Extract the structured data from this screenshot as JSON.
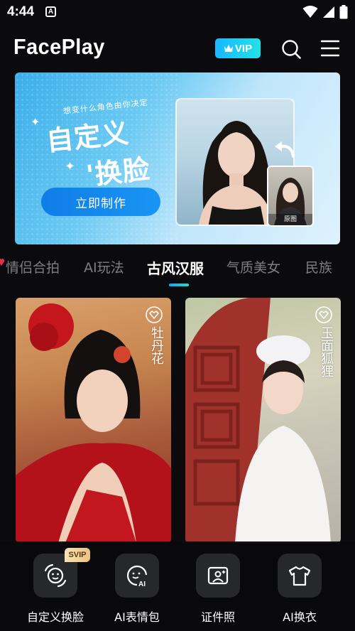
{
  "status_bar": {
    "time": "4:44",
    "notif_icon_letter": "A"
  },
  "header": {
    "logo": "FacePlay",
    "vip_label": "VIP"
  },
  "banner": {
    "subtitle": "想变什么角色由你决定",
    "title_line1": "自定义",
    "title_line2": "'换脸",
    "cta": "立即制作",
    "original_label": "原图"
  },
  "tabs": [
    {
      "label": "情侣合拍"
    },
    {
      "label": "AI玩法"
    },
    {
      "label": "古风汉服",
      "active": true
    },
    {
      "label": "气质美女"
    },
    {
      "label": "民族"
    }
  ],
  "cards": [
    {
      "calligraphy": "牡丹花"
    },
    {
      "calligraphy": "玉面狐狸"
    }
  ],
  "tools": [
    {
      "label": "自定义换脸",
      "badge": "SVIP",
      "icon": "face-swap-icon"
    },
    {
      "label": "AI表情包",
      "icon": "ai-emoji-icon"
    },
    {
      "label": "证件照",
      "icon": "id-photo-icon"
    },
    {
      "label": "AI换衣",
      "icon": "tshirt-icon"
    }
  ],
  "colors": {
    "accent": "#19b8ff",
    "background": "#0b0b0d",
    "tab_inactive": "#7d7d85"
  }
}
